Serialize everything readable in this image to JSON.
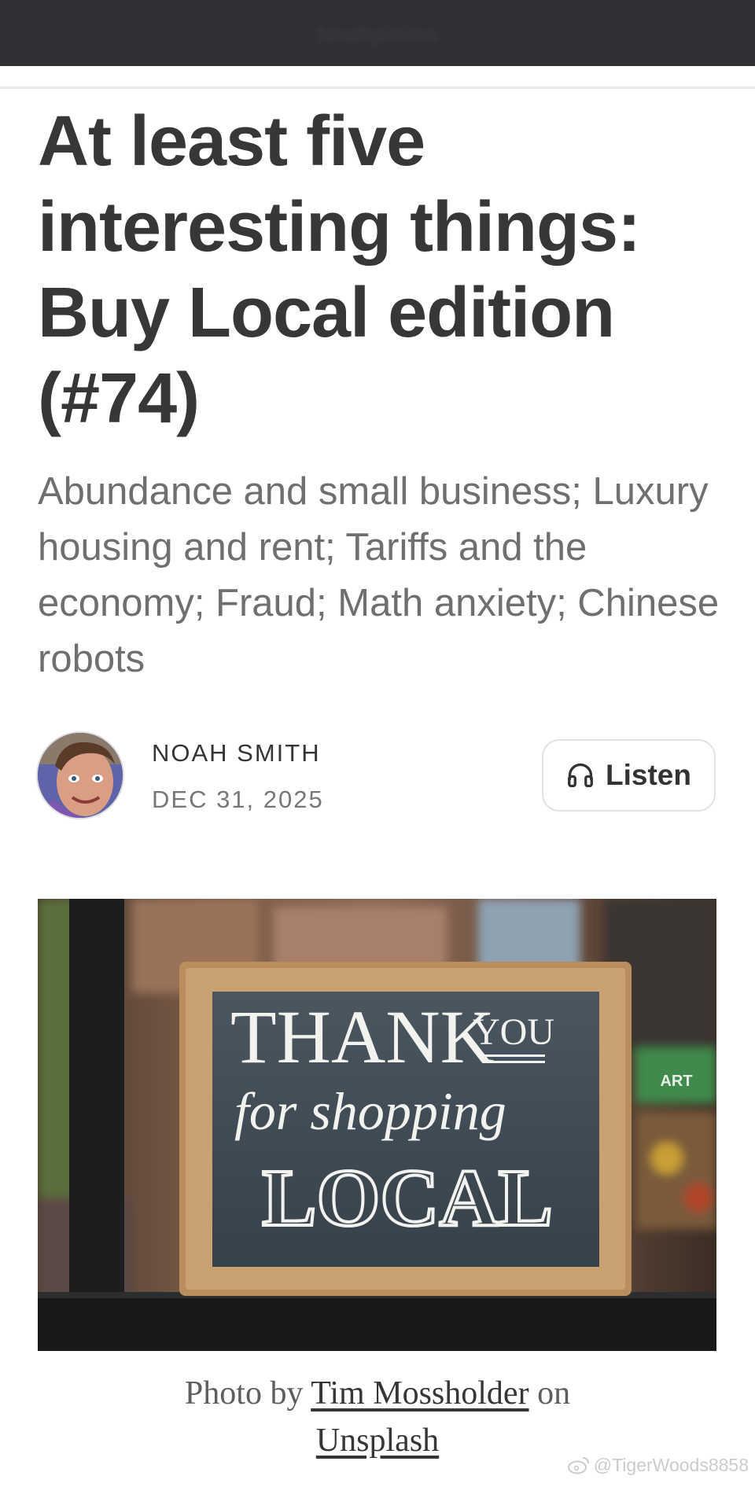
{
  "header": {
    "publication_name": "Noahpinion"
  },
  "article": {
    "title": "At least five interesting things: Buy Local edition (#74)",
    "subtitle": "Abundance and small business; Luxury housing and rent; Tariffs and the economy; Fraud; Math anxiety; Chinese robots",
    "author": "NOAH SMITH",
    "date": "DEC 31, 2025",
    "listen_label": "Listen",
    "listen_icon": "headphones-icon"
  },
  "hero_image": {
    "sign_line_1": "THANK",
    "sign_line_1b": "YOU",
    "sign_line_2": "for shopping",
    "sign_line_3": "LOCAL",
    "background_sign": "ART"
  },
  "caption": {
    "prefix": "Photo by",
    "photographer": "Tim Mossholder",
    "middle": "on",
    "source": "Unsplash"
  },
  "watermark": {
    "text": "@TigerWoods8858",
    "icon": "weibo-icon"
  },
  "colors": {
    "topbar": "#2f3033",
    "title": "#363737",
    "subtitle": "#6f6f6f",
    "chalkboard": "#3e4a54",
    "frame": "#b98e5e"
  }
}
